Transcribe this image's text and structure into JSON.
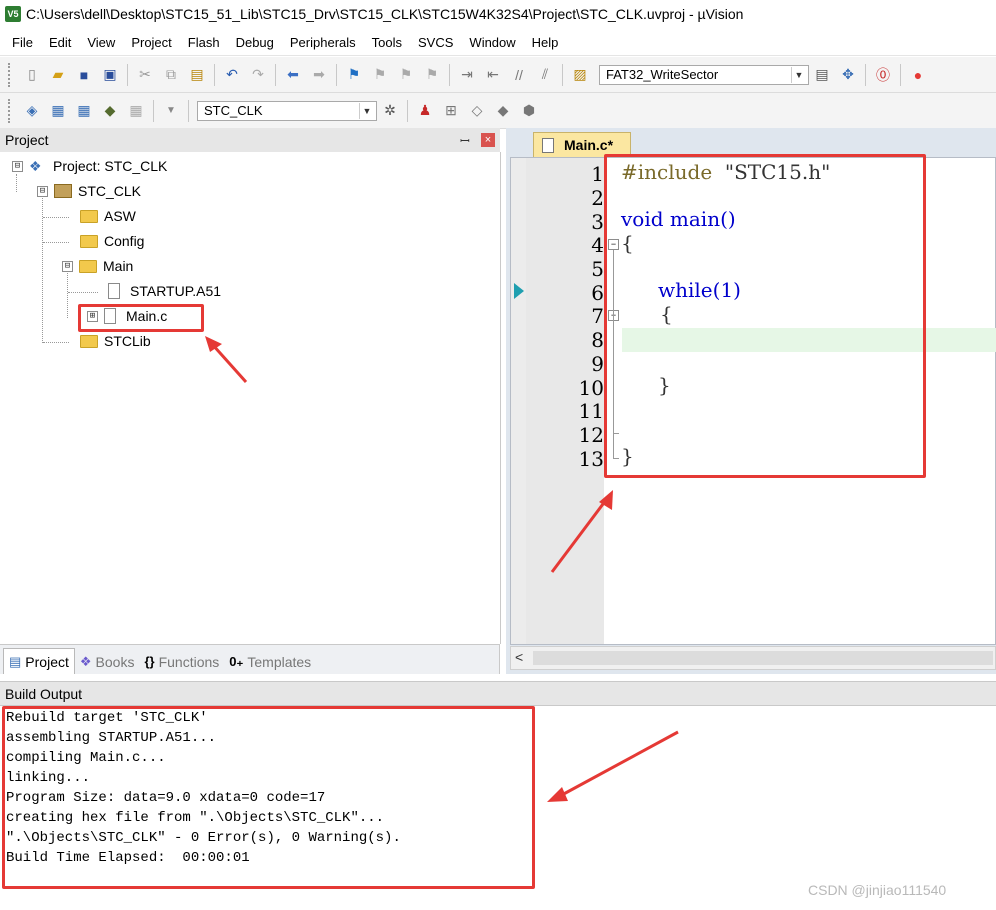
{
  "window": {
    "app_icon": "V5",
    "title": "C:\\Users\\dell\\Desktop\\STC15_51_Lib\\STC15_Drv\\STC15_CLK\\STC15W4K32S4\\Project\\STC_CLK.uvproj - µVision"
  },
  "menu": [
    "File",
    "Edit",
    "View",
    "Project",
    "Flash",
    "Debug",
    "Peripherals",
    "Tools",
    "SVCS",
    "Window",
    "Help"
  ],
  "toolbar1": {
    "target_function_combo": "FAT32_WriteSector"
  },
  "toolbar2": {
    "target_combo": "STC_CLK"
  },
  "project_panel": {
    "title": "Project",
    "pin_glyph": "ꟷ",
    "close_glyph": "×",
    "tree": [
      {
        "label": "Project: STC_CLK",
        "expander": "⊟"
      },
      {
        "label": "STC_CLK",
        "expander": "⊟"
      },
      {
        "label": "ASW"
      },
      {
        "label": "Config"
      },
      {
        "label": "Main",
        "expander": "⊟"
      },
      {
        "label": "STARTUP.A51"
      },
      {
        "label": "Main.c",
        "expander": "⊞"
      },
      {
        "label": "STCLib"
      }
    ],
    "tabs": [
      "Project",
      "Books",
      "Functions",
      "Templates"
    ]
  },
  "editor": {
    "tab_label": "Main.c*",
    "line_numbers": [
      "1",
      "2",
      "3",
      "4",
      "5",
      "6",
      "7",
      "8",
      "9",
      "10",
      "11",
      "12",
      "13"
    ],
    "code": {
      "l1_pp": "#include",
      "l1_str": "  \"STC15.h\"",
      "l3_kw": "void",
      "l3_rest": " main()",
      "l4": "{",
      "l6_kw": "while",
      "l6_rest": "(1)",
      "l7": "{",
      "l10": "}",
      "l13": "}"
    },
    "scroll_left_glyph": "<"
  },
  "build_output": {
    "title": "Build Output",
    "lines": [
      "Rebuild target 'STC_CLK'",
      "assembling STARTUP.A51...",
      "compiling Main.c...",
      "linking...",
      "Program Size: data=9.0 xdata=0 code=17",
      "creating hex file from \".\\Objects\\STC_CLK\"...",
      "\".\\Objects\\STC_CLK\" - 0 Error(s), 0 Warning(s).",
      "Build Time Elapsed:  00:00:01"
    ]
  },
  "watermark": "CSDN @jinjiao111540",
  "colors": {
    "annotation_red": "#e53935",
    "editor_tab": "#fbe7a1",
    "current_line": "#e6f7e6",
    "keyword": "#0000cc"
  }
}
